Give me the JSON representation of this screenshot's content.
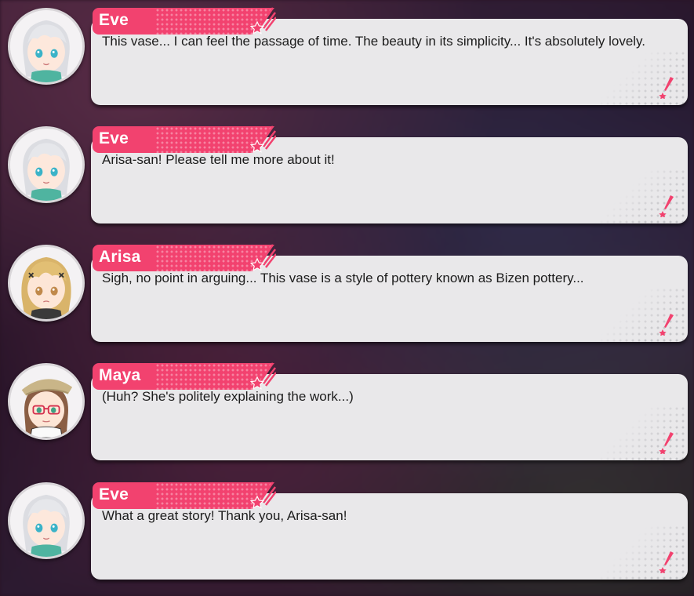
{
  "colors": {
    "accent": "#f2426f",
    "bubble": "#e9e8ea",
    "text": "#1c1c1c"
  },
  "entries": [
    {
      "speaker": "Eve",
      "avatar": "eve",
      "text": "This vase... I can feel the passage of time. The beauty in its simplicity... It's absolutely lovely."
    },
    {
      "speaker": "Eve",
      "avatar": "eve",
      "text": "Arisa-san! Please tell me more about it!"
    },
    {
      "speaker": "Arisa",
      "avatar": "arisa",
      "text": "Sigh, no point in arguing... This vase is a style of pottery known as Bizen pottery..."
    },
    {
      "speaker": "Maya",
      "avatar": "maya",
      "text": "(Huh? She's politely explaining the work...)"
    },
    {
      "speaker": "Eve",
      "avatar": "eve",
      "text": "What a great story! Thank you, Arisa-san!"
    }
  ],
  "icons": {
    "nameplate_decoration": "star-burst-icon",
    "message_end_marker": "quill-icon"
  }
}
